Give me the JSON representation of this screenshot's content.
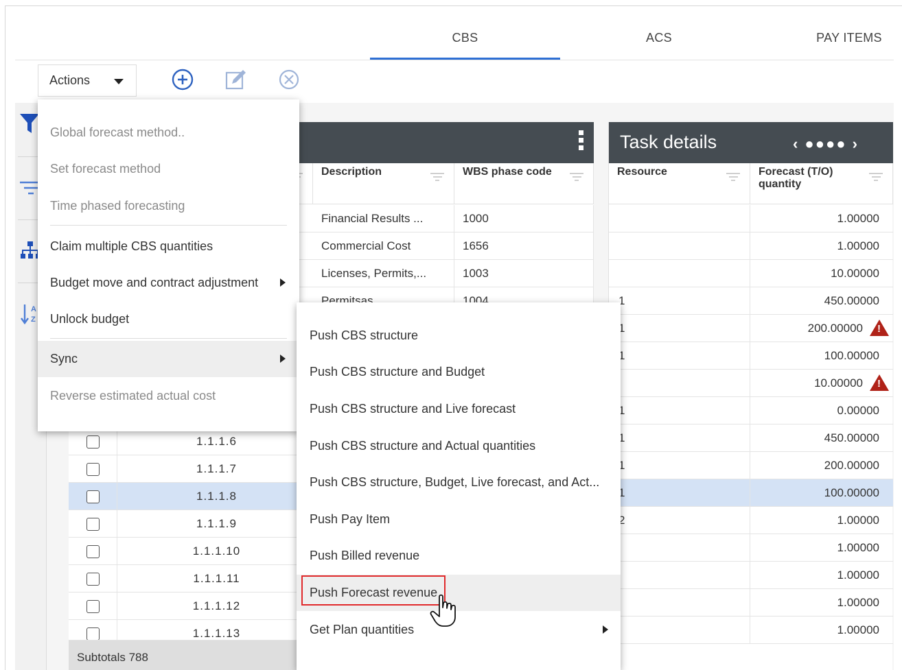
{
  "tabs": [
    "CBS",
    "ACS",
    "PAY ITEMS"
  ],
  "active_tab": "CBS",
  "toolbar": {
    "actions_label": "Actions"
  },
  "icons": {
    "add": "add-circle-icon",
    "edit": "edit-icon",
    "delete": "close-circle-icon",
    "rail": [
      "filter-funnel-icon",
      "filter-lines-icon",
      "hierarchy-icon",
      "sort-az-icon"
    ]
  },
  "colors": {
    "accent": "#2e6fd4",
    "panel_header": "#454c52",
    "warning": "#b02218",
    "highlight_box": "#e0292b",
    "selected_row": "#d4e2f5"
  },
  "grid": {
    "columns": [
      "Description",
      "WBS phase code"
    ],
    "rows_top": [
      {
        "description": "Financial Results ...",
        "wbs": "1000"
      },
      {
        "description": "Commercial Cost",
        "wbs": "1656"
      },
      {
        "description": "Licenses, Permits,...",
        "wbs": "1003"
      },
      {
        "description": "Permitsas",
        "wbs": "1004"
      }
    ],
    "rows_bottom": [
      {
        "code": "1.1.1.6"
      },
      {
        "code": "1.1.1.7"
      },
      {
        "code": "1.1.1.8",
        "selected": true
      },
      {
        "code": "1.1.1.9"
      },
      {
        "code": "1.1.1.10"
      },
      {
        "code": "1.1.1.11"
      },
      {
        "code": "1.1.1.12"
      },
      {
        "code": "1.1.1.13"
      }
    ],
    "subtotals": "Subtotals 788"
  },
  "task_details": {
    "title": "Task details",
    "nav": "‹ ●●●● ›",
    "columns": [
      "Resource",
      "Forecast (T/O) quantity"
    ],
    "rows": [
      {
        "resource": "",
        "qty": "1.00000"
      },
      {
        "resource": "",
        "qty": "1.00000"
      },
      {
        "resource": "",
        "qty": "10.00000"
      },
      {
        "resource": "1",
        "qty": "450.00000"
      },
      {
        "resource": "1",
        "qty": "200.00000",
        "warning": true
      },
      {
        "resource": "1",
        "qty": "100.00000"
      },
      {
        "resource": "",
        "qty": "10.00000",
        "warning": true
      },
      {
        "resource": "1",
        "qty": "0.00000"
      },
      {
        "resource": "1",
        "qty": "450.00000"
      },
      {
        "resource": "1",
        "qty": "200.00000"
      },
      {
        "resource": "1",
        "qty": "100.00000",
        "selected": true
      },
      {
        "resource": "2",
        "qty": "1.00000"
      },
      {
        "resource": "",
        "qty": "1.00000"
      },
      {
        "resource": "",
        "qty": "1.00000"
      },
      {
        "resource": "",
        "qty": "1.00000"
      },
      {
        "resource": "",
        "qty": "1.00000"
      }
    ]
  },
  "actions_menu": [
    {
      "label": "Global forecast method..",
      "disabled": true
    },
    {
      "label": "Set forecast method",
      "disabled": true
    },
    {
      "label": "Time phased forecasting",
      "disabled": true
    },
    {
      "label": "Claim multiple CBS quantities",
      "disabled": false
    },
    {
      "label": "Budget move and contract adjustment",
      "disabled": false,
      "submenu": true
    },
    {
      "label": "Unlock budget",
      "disabled": false
    },
    {
      "label": "Sync",
      "disabled": false,
      "submenu": true,
      "highlighted": true
    },
    {
      "label": "Reverse estimated actual cost",
      "disabled": true
    }
  ],
  "sync_submenu": [
    {
      "label": "Push CBS structure"
    },
    {
      "label": "Push CBS structure and Budget"
    },
    {
      "label": "Push CBS structure and Live forecast"
    },
    {
      "label": "Push CBS structure and Actual quantities"
    },
    {
      "label": "Push CBS structure, Budget, Live forecast, and Act..."
    },
    {
      "label": "Push Pay Item"
    },
    {
      "label": "Push Billed revenue"
    },
    {
      "label": "Push Forecast revenue",
      "highlighted": true
    },
    {
      "label": "Get Plan quantities",
      "submenu": true
    }
  ]
}
